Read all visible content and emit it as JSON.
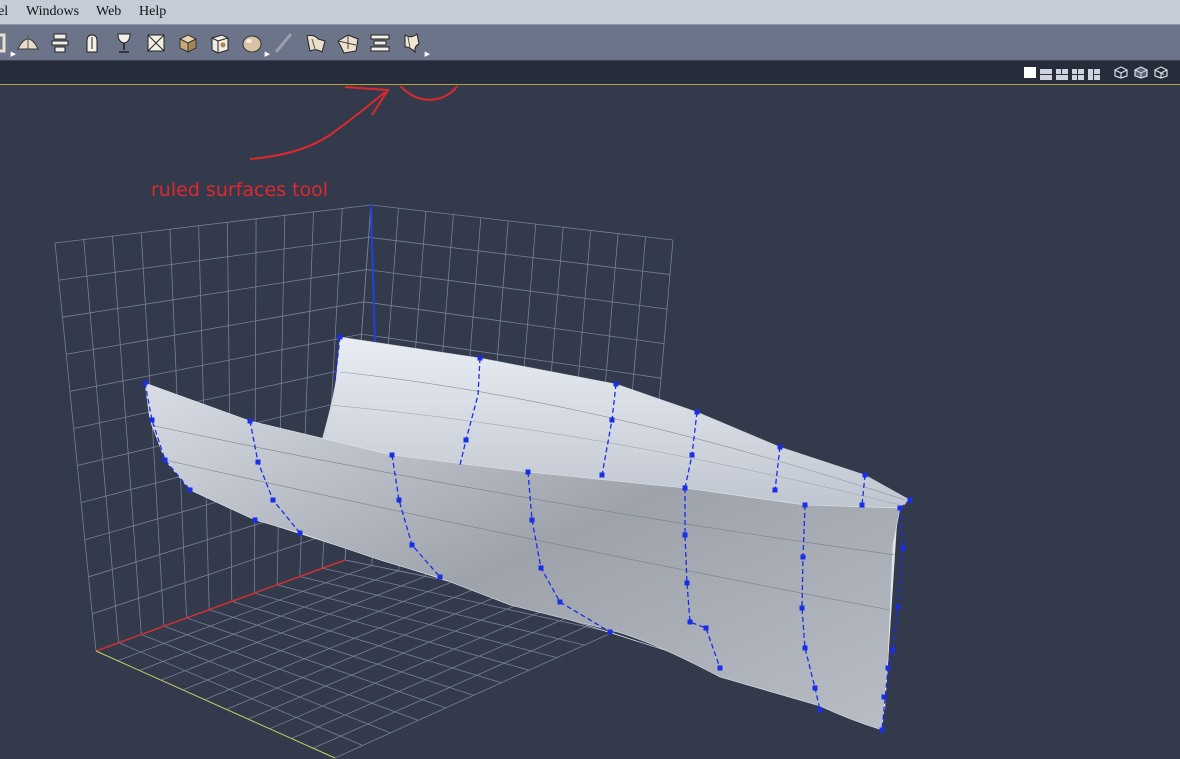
{
  "menu": {
    "items": [
      {
        "label": "el"
      },
      {
        "label": "Windows"
      },
      {
        "label": "Web"
      },
      {
        "label": "Help"
      }
    ]
  },
  "toolbar": {
    "tools": [
      {
        "icon": "bracket-icon"
      },
      {
        "icon": "dome-icon"
      },
      {
        "icon": "lathe-icon"
      },
      {
        "icon": "hand-icon"
      },
      {
        "icon": "goblet-icon"
      },
      {
        "icon": "boxed-x-icon"
      },
      {
        "icon": "box-icon"
      },
      {
        "icon": "package-icon"
      },
      {
        "icon": "sphere-icon"
      },
      {
        "icon": "pen-icon"
      },
      {
        "icon": "surface-icon"
      },
      {
        "icon": "sheet-icon"
      },
      {
        "icon": "mesh-icon"
      },
      {
        "icon": "ruled-surface-icon"
      }
    ]
  },
  "view_controls": {
    "layouts": [
      "single-view-icon",
      "two-view-icon",
      "three-view-icon",
      "four-view-icon",
      "grid-view-icon"
    ],
    "render_modes": [
      "wireframe-cube-icon",
      "shaded-cube-icon",
      "box-cube-icon"
    ]
  },
  "annotation": {
    "label": "ruled surfaces tool",
    "color": "#e0282c"
  },
  "colors": {
    "background": "#323a4c",
    "grid": "#7f889a",
    "control_points": "#1a2ee8",
    "x_axis": "#d03030",
    "y_axis": "#c8c860",
    "z_axis": "#2040e0",
    "surface": "#c9cfd9"
  }
}
